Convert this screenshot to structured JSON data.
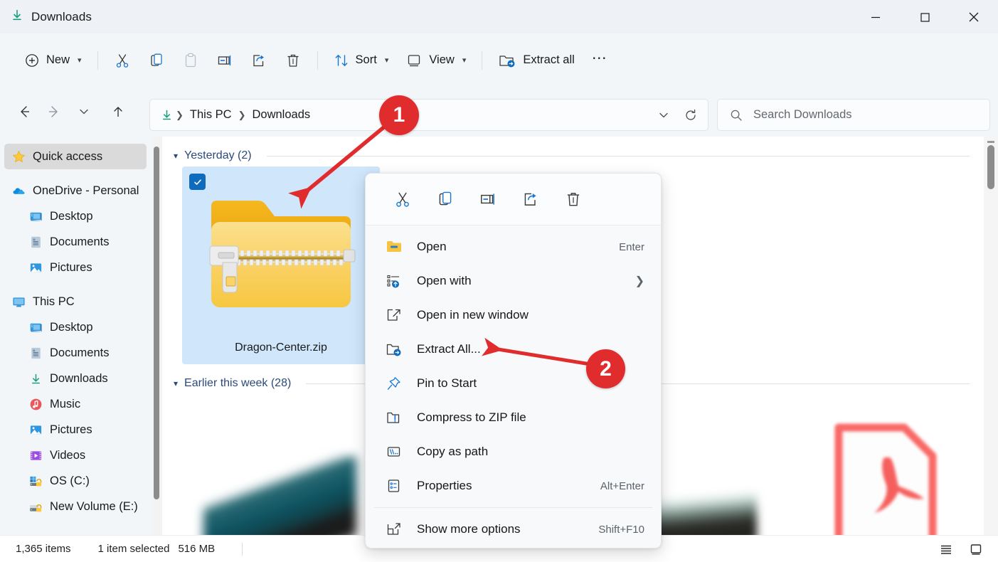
{
  "window": {
    "title": "Downloads",
    "title_icon": "download-arrow-icon",
    "controls": {
      "minimize": "minimize-icon",
      "maximize": "maximize-icon",
      "close": "close-icon"
    }
  },
  "toolbar": {
    "new_label": "New",
    "cut_icon": "scissors-icon",
    "copy_icon": "copy-icon",
    "paste_icon": "clipboard-icon",
    "rename_icon": "rename-icon",
    "share_icon": "share-icon",
    "delete_icon": "trash-icon",
    "sort_label": "Sort",
    "view_label": "View",
    "extract_all_label": "Extract all",
    "more_label": "See more"
  },
  "addressbar": {
    "back_icon": "back-arrow-icon",
    "forward_icon": "forward-arrow-icon",
    "recent_icon": "chevron-down-icon",
    "up_icon": "up-arrow-icon",
    "path_icon": "download-arrow-icon",
    "crumbs": [
      "This PC",
      "Downloads"
    ],
    "previous_locations_icon": "chevron-down-icon",
    "refresh_icon": "refresh-icon"
  },
  "search": {
    "icon": "search-icon",
    "placeholder": "Search Downloads",
    "value": ""
  },
  "sidebar": {
    "items": [
      {
        "label": "Quick access",
        "icon": "star-icon",
        "indent": false,
        "selected": true
      },
      {
        "label": "OneDrive - Personal",
        "icon": "cloud-icon",
        "indent": false,
        "selected": false
      },
      {
        "label": "Desktop",
        "icon": "desktop-icon",
        "indent": true,
        "selected": false
      },
      {
        "label": "Documents",
        "icon": "documents-icon",
        "indent": true,
        "selected": false
      },
      {
        "label": "Pictures",
        "icon": "pictures-icon",
        "indent": true,
        "selected": false
      },
      {
        "label": "This PC",
        "icon": "thispc-icon",
        "indent": false,
        "selected": false
      },
      {
        "label": "Desktop",
        "icon": "desktop-icon",
        "indent": true,
        "selected": false
      },
      {
        "label": "Documents",
        "icon": "documents-icon",
        "indent": true,
        "selected": false
      },
      {
        "label": "Downloads",
        "icon": "download-arrow-icon",
        "indent": true,
        "selected": false
      },
      {
        "label": "Music",
        "icon": "music-icon",
        "indent": true,
        "selected": false
      },
      {
        "label": "Pictures",
        "icon": "pictures-icon",
        "indent": true,
        "selected": false
      },
      {
        "label": "Videos",
        "icon": "videos-icon",
        "indent": true,
        "selected": false
      },
      {
        "label": "OS (C:)",
        "icon": "drive-icon",
        "indent": true,
        "selected": false
      },
      {
        "label": "New Volume (E:)",
        "icon": "drive-icon",
        "indent": true,
        "selected": false
      }
    ]
  },
  "content": {
    "groups": [
      {
        "title": "Yesterday (2)",
        "chevron": "chevron-down-icon"
      },
      {
        "title": "Earlier this week (28)",
        "chevron": "chevron-down-icon"
      }
    ],
    "file": {
      "name": "Dragon-Center.zip",
      "icon": "zip-folder-icon",
      "selected": true,
      "checkbox_icon": "checkmark-icon"
    }
  },
  "context_menu": {
    "top_actions": [
      {
        "name": "cut",
        "icon": "scissors-icon"
      },
      {
        "name": "copy",
        "icon": "copy-icon"
      },
      {
        "name": "rename",
        "icon": "rename-icon"
      },
      {
        "name": "share",
        "icon": "share-icon"
      },
      {
        "name": "delete",
        "icon": "trash-icon"
      }
    ],
    "items": [
      {
        "label": "Open",
        "icon": "folder-icon",
        "accel": "Enter",
        "submenu": false
      },
      {
        "label": "Open with",
        "icon": "open-with-icon",
        "accel": "",
        "submenu": true
      },
      {
        "label": "Open in new window",
        "icon": "new-window-icon",
        "accel": "",
        "submenu": false
      },
      {
        "label": "Extract All...",
        "icon": "extract-icon",
        "accel": "",
        "submenu": false
      },
      {
        "label": "Pin to Start",
        "icon": "pin-icon",
        "accel": "",
        "submenu": false
      },
      {
        "label": "Compress to ZIP file",
        "icon": "zip-icon",
        "accel": "",
        "submenu": false
      },
      {
        "label": "Copy as path",
        "icon": "copy-path-icon",
        "accel": "",
        "submenu": false
      },
      {
        "label": "Properties",
        "icon": "properties-icon",
        "accel": "Alt+Enter",
        "submenu": false
      },
      {
        "label": "Show more options",
        "icon": "more-options-icon",
        "accel": "Shift+F10",
        "submenu": false
      }
    ]
  },
  "statusbar": {
    "item_count": "1,365 items",
    "selection": "1 item selected",
    "selection_size": "516 MB",
    "details_view_icon": "details-view-icon",
    "large_icons_view_icon": "large-icons-view-icon"
  },
  "annotations": {
    "markers": [
      {
        "number": "1",
        "color": "#e02c2c"
      },
      {
        "number": "2",
        "color": "#e02c2c"
      }
    ]
  }
}
